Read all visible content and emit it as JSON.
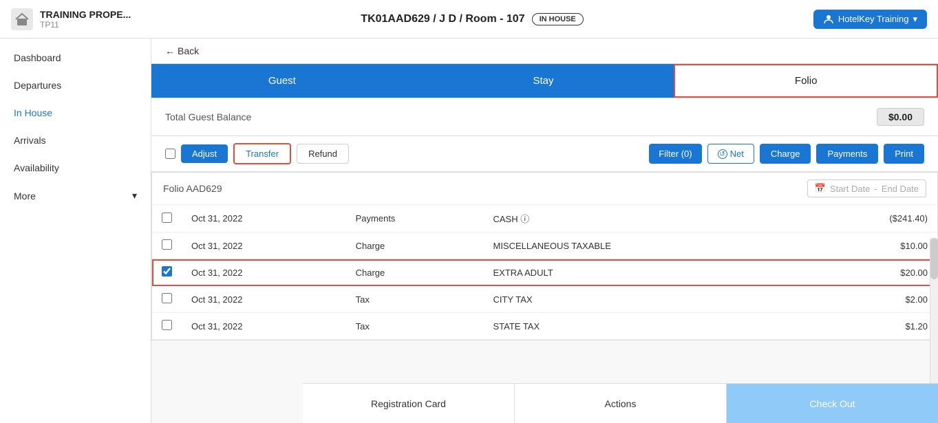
{
  "header": {
    "logo_text": "🏠",
    "property_name": "TRAINING PROPE...",
    "property_code": "TP11",
    "reservation_title": "TK01AAD629 / J D / Room - 107",
    "status_badge": "IN HOUSE",
    "user_name": "HotelKey Training"
  },
  "sidebar": {
    "items": [
      {
        "label": "Dashboard",
        "active": false
      },
      {
        "label": "Departures",
        "active": false
      },
      {
        "label": "In House",
        "active": true
      },
      {
        "label": "Arrivals",
        "active": false
      },
      {
        "label": "Availability",
        "active": false
      },
      {
        "label": "More",
        "active": false,
        "has_arrow": true
      }
    ]
  },
  "back": {
    "label": "Back"
  },
  "tabs": [
    {
      "label": "Guest",
      "active": false
    },
    {
      "label": "Stay",
      "active": false
    },
    {
      "label": "Folio",
      "active": true
    }
  ],
  "balance": {
    "label": "Total Guest Balance",
    "value": "$0.00"
  },
  "actions": {
    "adjust": "Adjust",
    "transfer": "Transfer",
    "refund": "Refund",
    "filter": "Filter (0)",
    "net": "Net",
    "charge": "Charge",
    "payments": "Payments",
    "print": "Print"
  },
  "folio": {
    "title": "Folio AAD629",
    "start_date_placeholder": "Start Date",
    "end_date_placeholder": "End Date",
    "rows": [
      {
        "date": "Oct 31, 2022",
        "type": "Payments",
        "description": "CASH ⓘ",
        "amount": "($241.40)",
        "checked": false,
        "selected": false
      },
      {
        "date": "Oct 31, 2022",
        "type": "Charge",
        "description": "MISCELLANEOUS TAXABLE",
        "amount": "$10.00",
        "checked": false,
        "selected": false
      },
      {
        "date": "Oct 31, 2022",
        "type": "Charge",
        "description": "EXTRA ADULT",
        "amount": "$20.00",
        "checked": true,
        "selected": true
      },
      {
        "date": "Oct 31, 2022",
        "type": "Tax",
        "description": "CITY TAX",
        "amount": "$2.00",
        "checked": false,
        "selected": false
      },
      {
        "date": "Oct 31, 2022",
        "type": "Tax",
        "description": "STATE TAX",
        "amount": "$1.20",
        "checked": false,
        "selected": false
      }
    ]
  },
  "footer": {
    "registration_card": "Registration Card",
    "actions": "Actions",
    "check_out": "Check Out"
  },
  "colors": {
    "primary": "#1976d2",
    "active_nav": "#1976d2",
    "red_border": "#e74c3c",
    "checkout_bg": "#90caf9"
  }
}
